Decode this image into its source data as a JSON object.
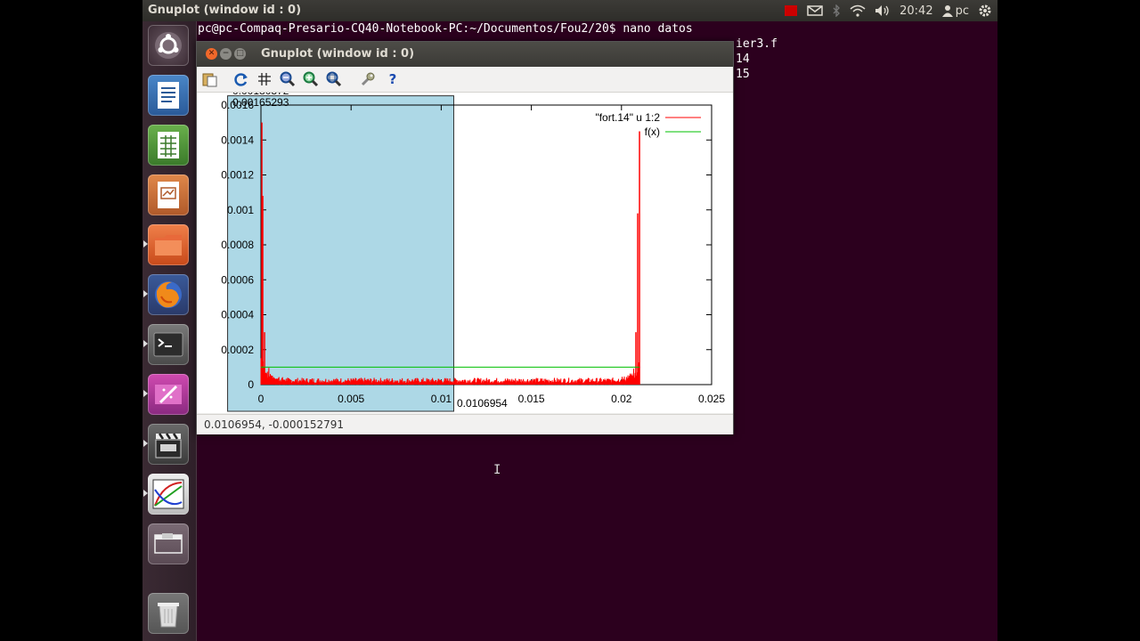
{
  "topbar": {
    "title": "Gnuplot (window id : 0)",
    "time": "20:42",
    "user": "pc"
  },
  "launcher": {
    "items": [
      {
        "name": "dash-home"
      },
      {
        "name": "libreoffice-writer"
      },
      {
        "name": "libreoffice-calc"
      },
      {
        "name": "libreoffice-impress"
      },
      {
        "name": "files"
      },
      {
        "name": "firefox"
      },
      {
        "name": "terminal"
      },
      {
        "name": "image-editor"
      },
      {
        "name": "video-editor"
      },
      {
        "name": "gnuplot"
      },
      {
        "name": "window"
      },
      {
        "name": "trash"
      }
    ]
  },
  "terminal": {
    "line1": "pc@pc-Compaq-Presario-CQ40-Notebook-PC:~/Documentos/Fou2/20$ nano datos",
    "line2_tail": "ier3.f",
    "line3_tail": "14",
    "line4_tail": "15"
  },
  "gnuplot": {
    "title": "Gnuplot (window id : 0)",
    "status": "0.0106954, -0.000152791",
    "zoom_top_label": "0.00165293",
    "zoom_top_label_partial": "0.00180372",
    "zoom_x_label": "0.0106954"
  },
  "chart_data": {
    "type": "line",
    "xlim": [
      0,
      0.025
    ],
    "ylim": [
      0,
      0.0016
    ],
    "xticks": [
      "0",
      "0.005",
      "0.01",
      "0.015",
      "0.02",
      "0.025"
    ],
    "yticks": [
      "0",
      "0.0002",
      "0.0004",
      "0.0006",
      "0.0008",
      "0.001",
      "0.0012",
      "0.0014",
      "0.0016"
    ],
    "series": [
      {
        "name": "\"fort.14\" u 1:2",
        "color": "#ff0000",
        "peaks": [
          [
            5e-05,
            0.0015
          ],
          [
            0.0001,
            0.00108
          ],
          [
            0.0002,
            0.0003
          ],
          [
            0.0208,
            0.0003
          ],
          [
            0.0209,
            0.00098
          ],
          [
            0.021,
            0.00145
          ]
        ],
        "baseline": 3e-05,
        "x_end": 0.021
      },
      {
        "name": "f(x)",
        "color": "#00c000",
        "value": 0.0001,
        "x_range": [
          0,
          0.021
        ]
      }
    ],
    "zoom_box": {
      "x": [
        -0.00185,
        0.0106954
      ],
      "y": [
        -0.000152791,
        0.00165293
      ]
    },
    "grid": false,
    "legend": "top-right"
  }
}
